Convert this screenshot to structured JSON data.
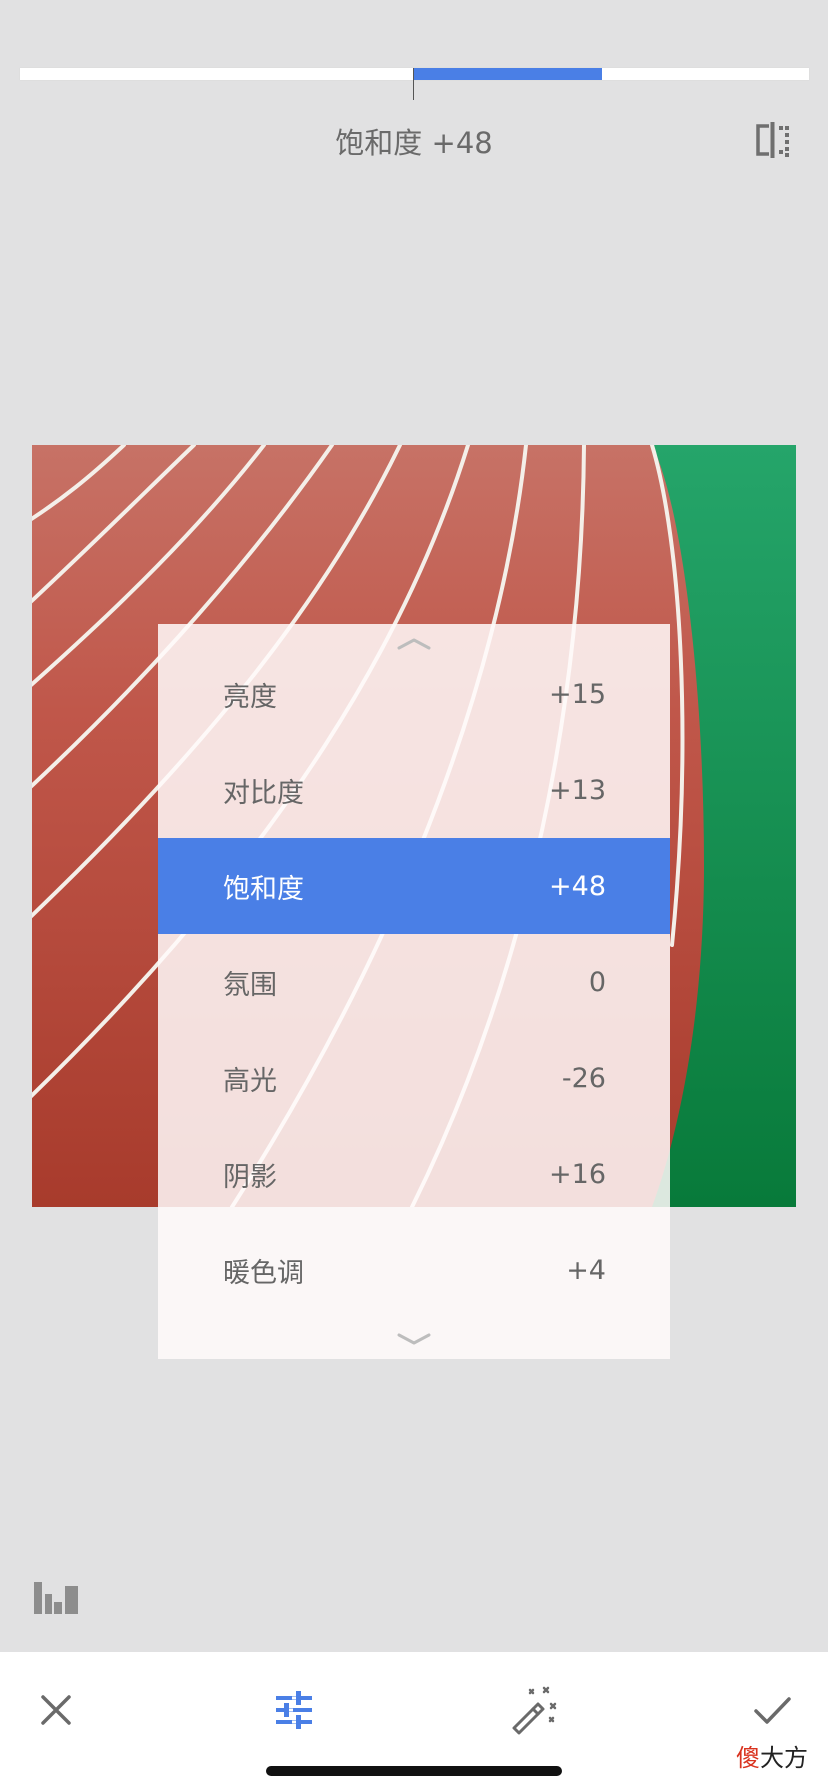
{
  "slider": {
    "value": 48,
    "min": -100,
    "max": 100,
    "fill_color": "#4a7fe6"
  },
  "header": {
    "param_name": "饱和度",
    "param_value": "+48",
    "compare_icon": "compare-split-icon"
  },
  "menu": {
    "up_icon": "chevron-up-icon",
    "down_icon": "chevron-down-icon",
    "active_index": 2,
    "items": [
      {
        "label": "亮度",
        "value": "+15"
      },
      {
        "label": "对比度",
        "value": "+13"
      },
      {
        "label": "饱和度",
        "value": "+48"
      },
      {
        "label": "氛围",
        "value": "0"
      },
      {
        "label": "高光",
        "value": "-26"
      },
      {
        "label": "阴影",
        "value": "+16"
      },
      {
        "label": "暖色调",
        "value": "+4"
      }
    ]
  },
  "histogram_icon": "histogram-icon",
  "bottom_bar": {
    "cancel_icon": "close-icon",
    "adjust_icon": "sliders-icon",
    "auto_icon": "magic-wand-icon",
    "apply_icon": "checkmark-icon"
  },
  "watermark": {
    "red_char": "傻",
    "rest": "大方"
  },
  "colors": {
    "accent": "#4a7fe6",
    "background": "#e1e1e2",
    "track_red": "#b5473a",
    "field_green": "#0c8a45"
  }
}
